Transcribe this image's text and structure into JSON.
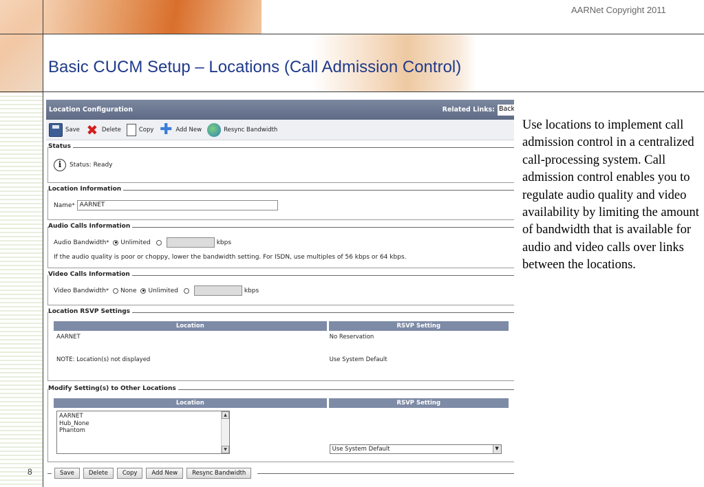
{
  "slide": {
    "copyright": "AARNet Copyright 2011",
    "title": "Basic CUCM Setup – Locations (Call Admission Control)",
    "page_number": "8",
    "side_text": "Use locations to implement call admission control in a centralized call-processing system. Call admission control enables you to regulate audio quality and video availability by limiting the amount of bandwidth that is available for audio and video calls over links between the locations."
  },
  "cucm": {
    "header_title": "Location Configuration",
    "related_links_label": "Related Links:",
    "related_links_value": "Back",
    "toolbar": {
      "save": "Save",
      "delete": "Delete",
      "copy": "Copy",
      "add_new": "Add New",
      "resync": "Resync Bandwidth"
    },
    "status": {
      "legend": "Status",
      "text": "Status: Ready"
    },
    "location_info": {
      "legend": "Location Information",
      "name_label": "Name",
      "name_value": "AARNET"
    },
    "audio": {
      "legend": "Audio Calls Information",
      "label": "Audio Bandwidth",
      "unlimited": "Unlimited",
      "unit": "kbps",
      "note": "If the audio quality is poor or choppy, lower the bandwidth setting. For ISDN, use multiples of 56 kbps or 64 kbps."
    },
    "video": {
      "legend": "Video Calls Information",
      "label": "Video Bandwidth",
      "none": "None",
      "unlimited": "Unlimited",
      "unit": "kbps"
    },
    "rsvp": {
      "legend": "Location RSVP Settings",
      "col_location": "Location",
      "col_setting": "RSVP Setting",
      "rows": [
        {
          "location": "AARNET",
          "setting": "No Reservation"
        },
        {
          "location": "NOTE: Location(s) not displayed",
          "setting": "Use System Default"
        }
      ]
    },
    "modify": {
      "legend": "Modify Setting(s) to Other Locations",
      "col_location": "Location",
      "col_setting": "RSVP Setting",
      "locations": [
        "AARNET",
        "Hub_None",
        "Phantom"
      ],
      "selected_setting": "Use System Default"
    },
    "bottom_buttons": {
      "save": "Save",
      "delete": "Delete",
      "copy": "Copy",
      "add_new": "Add New",
      "resync": "Resync Bandwidth"
    }
  },
  "colors": {
    "title_blue": "#1f3a8a",
    "header_bg": "#5f6b85",
    "accent_orange": "#d96f2c"
  }
}
